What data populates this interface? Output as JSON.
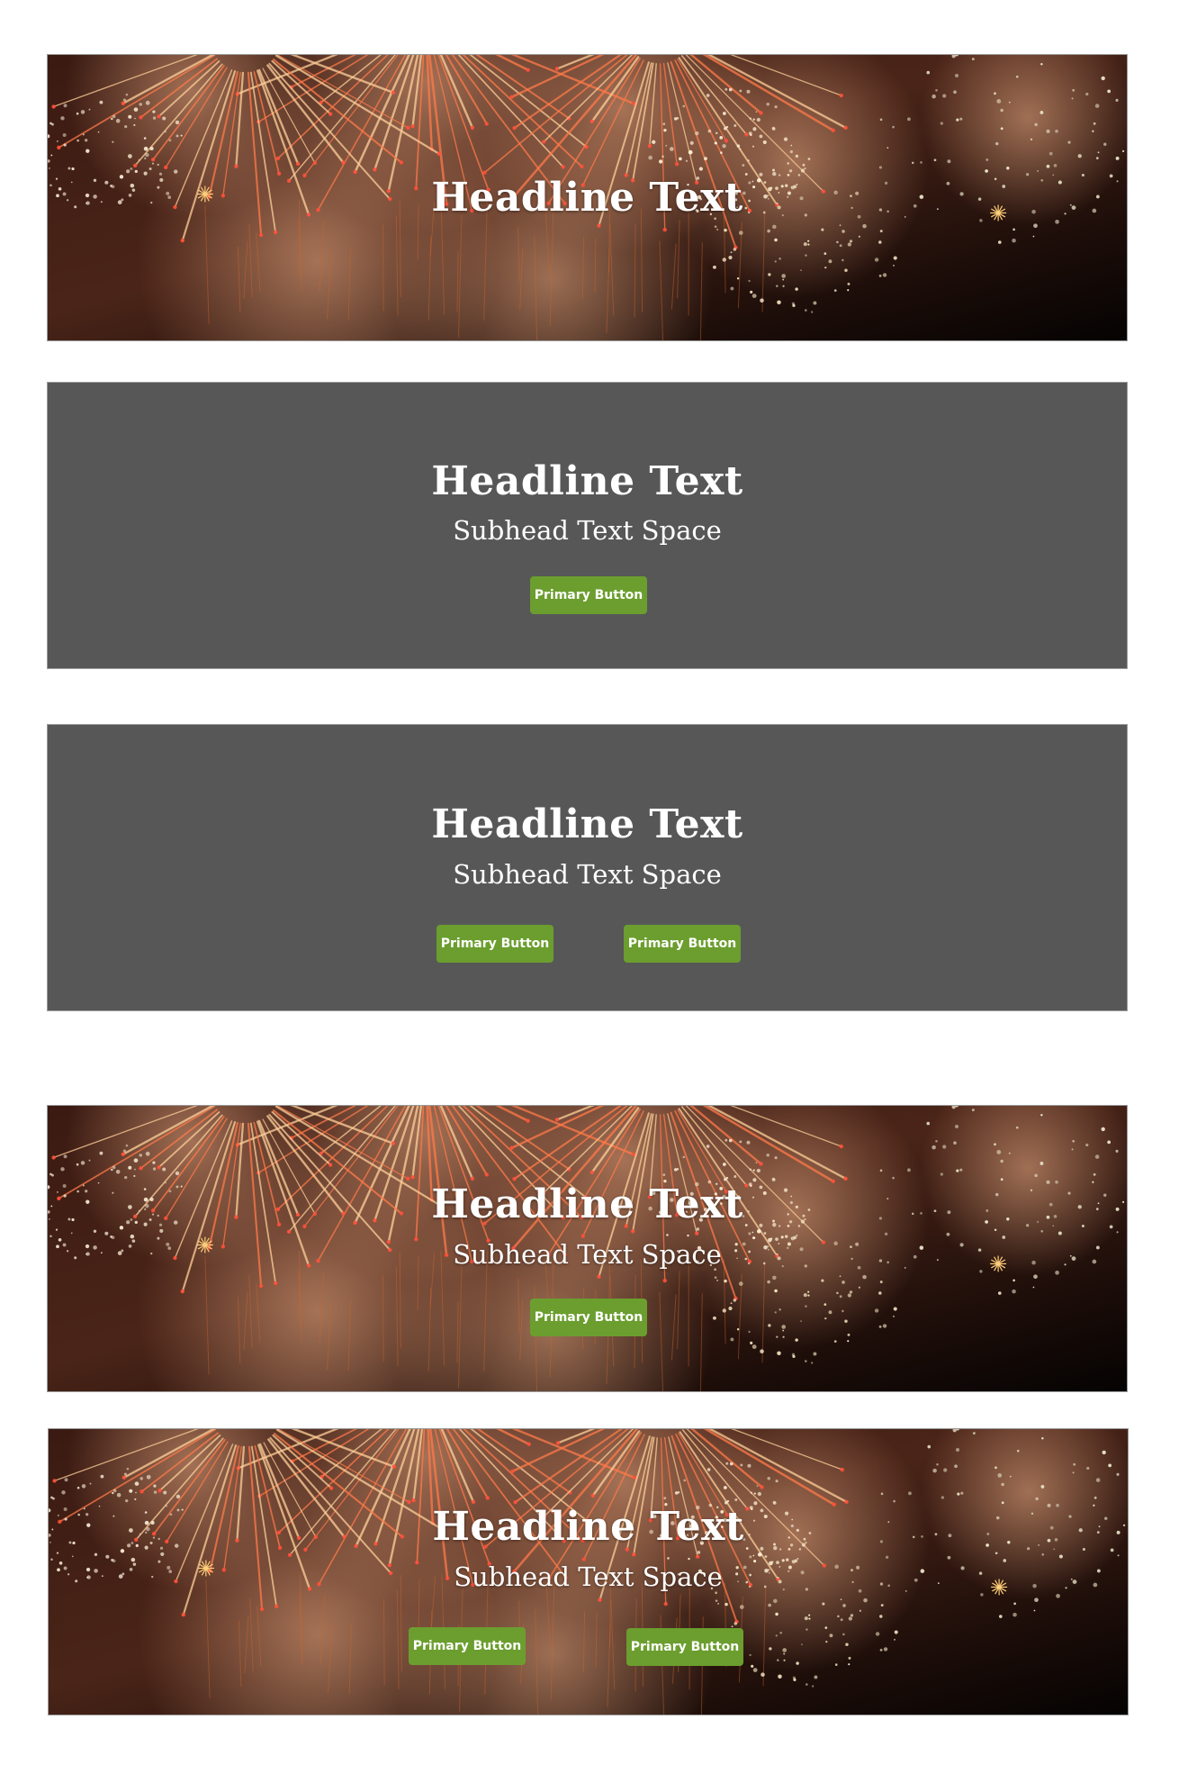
{
  "banners": [
    {
      "variant": "photo",
      "headline": "Headline Text"
    },
    {
      "variant": "solid",
      "headline": "Headline Text",
      "subhead": "Subhead Text Space",
      "buttons": [
        "Primary Button"
      ]
    },
    {
      "variant": "solid",
      "headline": "Headline Text",
      "subhead": "Subhead Text Space",
      "buttons": [
        "Primary Button",
        "Primary Button"
      ]
    },
    {
      "variant": "photo",
      "headline": "Headline Text",
      "subhead": "Subhead Text Space",
      "buttons": [
        "Primary Button"
      ]
    },
    {
      "variant": "photo",
      "headline": "Headline Text",
      "subhead": "Subhead Text Space",
      "buttons": [
        "Primary Button",
        "Primary Button"
      ]
    }
  ],
  "colors": {
    "page_background": "#ffffff",
    "solid_banner_background": "#575757",
    "photo_banner_base": "#120806",
    "button_background": "#6b9e2e",
    "text": "#ffffff"
  },
  "background_image": {
    "subject": "fireworks-photo"
  }
}
